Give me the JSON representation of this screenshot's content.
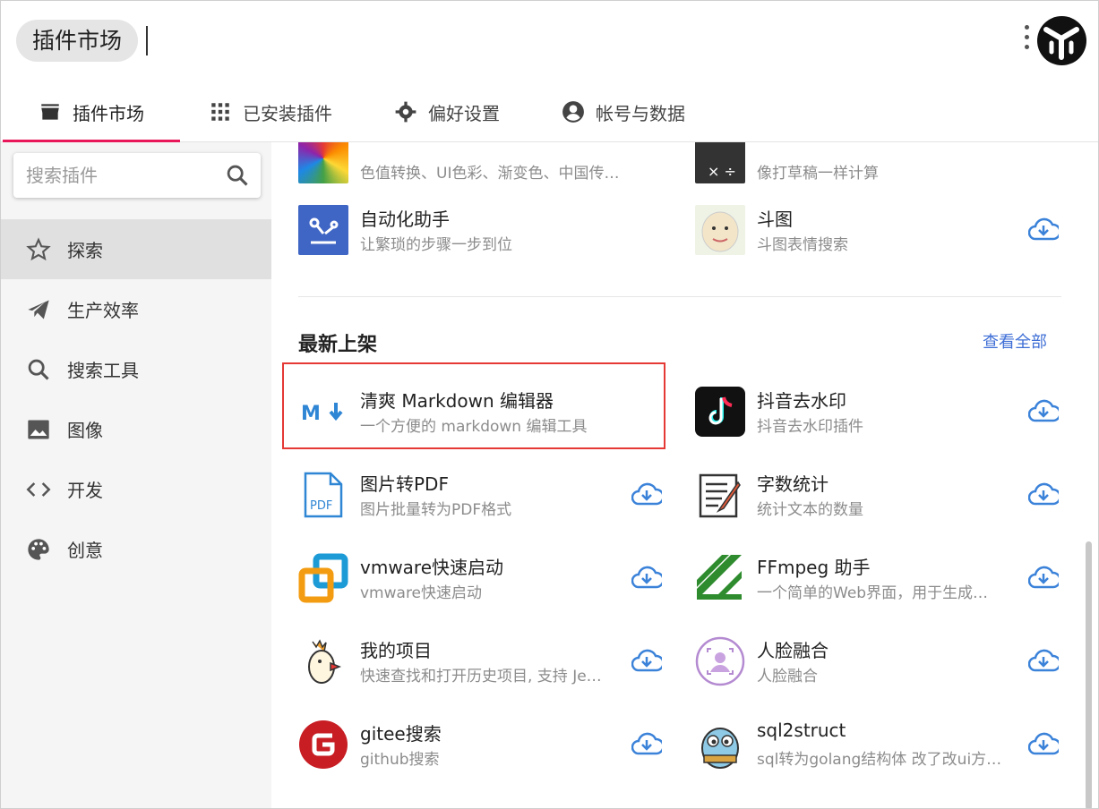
{
  "header": {
    "app_title": "插件市场"
  },
  "tabs": [
    {
      "label": "插件市场",
      "icon": "store-icon"
    },
    {
      "label": "已安装插件",
      "icon": "apps-grid-icon"
    },
    {
      "label": "偏好设置",
      "icon": "gear-icon"
    },
    {
      "label": "帐号与数据",
      "icon": "account-circle-icon"
    }
  ],
  "search": {
    "placeholder": "搜索插件"
  },
  "sidebar": {
    "items": [
      {
        "label": "探索",
        "icon": "star-icon"
      },
      {
        "label": "生产效率",
        "icon": "send-icon"
      },
      {
        "label": "搜索工具",
        "icon": "search-icon"
      },
      {
        "label": "图像",
        "icon": "image-icon"
      },
      {
        "label": "开发",
        "icon": "code-icon"
      },
      {
        "label": "创意",
        "icon": "palette-icon"
      }
    ]
  },
  "top_plugins": [
    {
      "title": "",
      "desc": "色值转换、UI色彩、渐变色、中国传统…",
      "icon": "color-wheel-icon"
    },
    {
      "title": "",
      "desc": "像打草稿一样计算",
      "icon": "calculator-icon"
    },
    {
      "title": "自动化助手",
      "desc": "让繁琐的步骤一步到位",
      "icon": "robot-arm-icon"
    },
    {
      "title": "斗图",
      "desc": "斗图表情搜索",
      "icon": "meme-face-icon"
    }
  ],
  "newest": {
    "section_title": "最新上架",
    "see_all": "查看全部",
    "plugins": [
      {
        "title": "清爽 Markdown 编辑器",
        "desc": "一个方便的 markdown 编辑工具",
        "icon": "markdown-icon"
      },
      {
        "title": "抖音去水印",
        "desc": "抖音去水印插件",
        "icon": "tiktok-icon"
      },
      {
        "title": "图片转PDF",
        "desc": "图片批量转为PDF格式",
        "icon": "pdf-file-icon"
      },
      {
        "title": "字数统计",
        "desc": "统计文本的数量",
        "icon": "document-pen-icon"
      },
      {
        "title": "vmware快速启动",
        "desc": "vmware快速启动",
        "icon": "vmware-icon"
      },
      {
        "title": "FFmpeg 助手",
        "desc": "一个简单的Web界面，用于生成…",
        "icon": "ffmpeg-icon"
      },
      {
        "title": "我的项目",
        "desc": "快速查找和打开历史项目, 支持 Je…",
        "icon": "rooster-icon"
      },
      {
        "title": "人脸融合",
        "desc": "人脸融合",
        "icon": "face-frame-icon"
      },
      {
        "title": "gitee搜索",
        "desc": "github搜索",
        "icon": "gitee-icon"
      },
      {
        "title": "sql2struct",
        "desc": "sql转为golang结构体 改了改ui方…",
        "icon": "gopher-icon"
      }
    ]
  },
  "colors": {
    "accent": "#e8185b",
    "link": "#3f6fd6",
    "download": "#3b82d9",
    "highlight_border": "#e53935"
  }
}
